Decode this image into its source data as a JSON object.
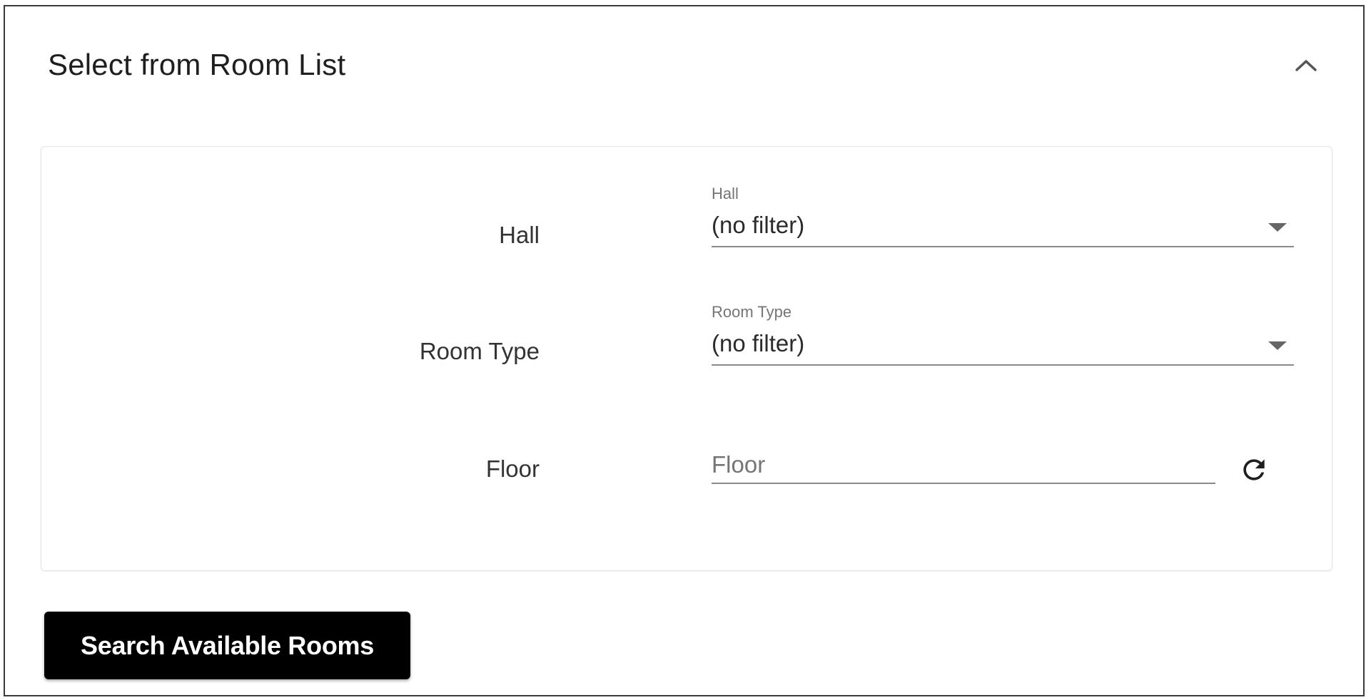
{
  "panel": {
    "title": "Select from Room List",
    "collapse_icon": "chevron-up-icon"
  },
  "form": {
    "hall": {
      "row_label": "Hall",
      "float_label": "Hall",
      "value": "(no filter)"
    },
    "room_type": {
      "row_label": "Room Type",
      "float_label": "Room Type",
      "value": "(no filter)"
    },
    "floor": {
      "row_label": "Floor",
      "placeholder": "Floor",
      "value": "",
      "reset_icon": "refresh-icon"
    }
  },
  "actions": {
    "search_label": "Search Available Rooms"
  },
  "colors": {
    "button_bg": "#000000",
    "button_text": "#ffffff",
    "underline": "#8a8a8a"
  }
}
